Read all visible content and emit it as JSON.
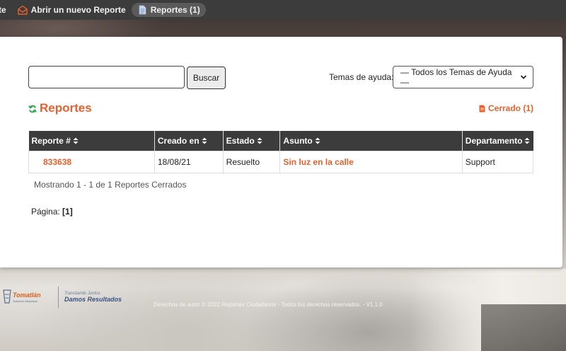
{
  "nav": {
    "items": [
      {
        "label": "te",
        "icon": "home-icon"
      },
      {
        "label": "Abrir un nuevo Reporte",
        "icon": "envelope-open-icon"
      },
      {
        "label": "Reportes (1)",
        "icon": "file-text-icon",
        "active": true
      }
    ]
  },
  "search": {
    "value": "",
    "placeholder": "",
    "button_label": "Buscar"
  },
  "help_topics": {
    "label": "Temas de ayuda:",
    "selected": "— Todos los Temas de Ayuda —"
  },
  "section": {
    "title": "Reportes",
    "icon": "refresh-icon",
    "closed_link": "Cerrado (1)",
    "closed_icon": "file-icon"
  },
  "table": {
    "columns": [
      "Reporte #",
      "Creado en",
      "Estado",
      "Asunto",
      "Departamento"
    ],
    "rows": [
      {
        "number": "833638",
        "created": "18/08/21",
        "status": "Resuelto",
        "subject": "Sin luz en la calle",
        "department": "Support"
      }
    ]
  },
  "summary": "Mostrando 1 - 1 de 1 Reportes Cerrados",
  "pagination": {
    "label": "Página:",
    "current": "[1]"
  },
  "footer": {
    "brand": "Tomatlán",
    "brand_sub": "Gobierno Municipal",
    "tagline_top": "Transitando Juntos",
    "tagline_bottom": "Damos Resultados",
    "copyright": "Derechos de autor © 2022 Reportes Ciudadanos - Todos los derechos reservados. - V1.1.0"
  },
  "colors": {
    "accent": "#e8602c",
    "navbar": "#3c3c3c",
    "table_header": "#3c3c3c"
  }
}
